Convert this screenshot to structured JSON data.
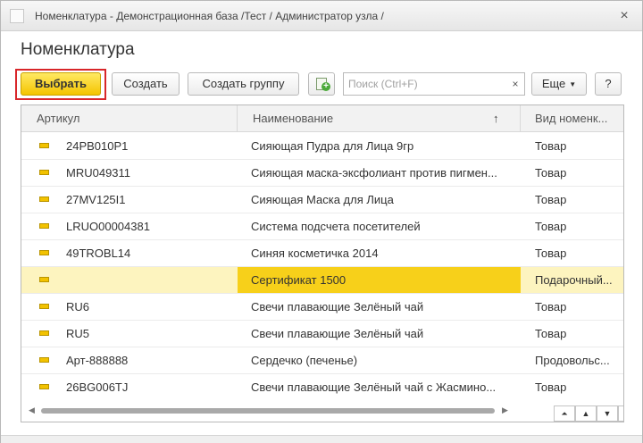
{
  "window": {
    "title": "Номенклатура - Демонстрационная база /Тест / Администратор узла /",
    "close_icon": "×"
  },
  "form": {
    "title": "Номенклатура"
  },
  "toolbar": {
    "select_label": "Выбрать",
    "create_label": "Создать",
    "create_group_label": "Создать группу",
    "search_placeholder": "Поиск (Ctrl+F)",
    "search_value": "",
    "clear_icon": "×",
    "more_label": "Еще",
    "more_caret": "▼",
    "help_label": "?"
  },
  "table": {
    "columns": {
      "article": "Артикул",
      "name": "Наименование",
      "sort_indicator": "↑",
      "kind": "Вид номенк..."
    },
    "rows": [
      {
        "article": "24PB010P1",
        "name": "Сияющая Пудра для Лица 9гр",
        "kind": "Товар"
      },
      {
        "article": "MRU049311",
        "name": "Сияющая маска-эксфолиант против пигмен...",
        "kind": "Товар"
      },
      {
        "article": "27MV125I1",
        "name": "Сияющая Маска для Лица",
        "kind": "Товар"
      },
      {
        "article": "LRUO00004381",
        "name": "Система подсчета посетителей",
        "kind": "Товар"
      },
      {
        "article": "49TROBL14",
        "name": "Синяя косметичка 2014",
        "kind": "Товар"
      },
      {
        "article": "",
        "name": "Сертификат 1500",
        "kind": "Подарочный...",
        "selected": true
      },
      {
        "article": "RU6",
        "name": "Свечи плавающие Зелёный чай",
        "kind": "Товар"
      },
      {
        "article": "RU5",
        "name": "Свечи плавающие Зелёный чай",
        "kind": "Товар"
      },
      {
        "article": "Арт-888888",
        "name": "Сердечко (печенье)",
        "kind": "Продовольс..."
      },
      {
        "article": "26BG006TJ",
        "name": "Свечи плавающие Зелёный чай с Жасмино...",
        "kind": "Товар"
      }
    ],
    "nav": {
      "first": "⏶",
      "prev": "▲",
      "next": "▼",
      "last": "⏷"
    },
    "scroll": {
      "left": "◀",
      "right": "▶"
    }
  },
  "colors": {
    "primary_button": "#f4c400",
    "selected_row": "#fdf4bf",
    "selected_cell": "#f7d01a",
    "highlight_frame": "#d8262a"
  }
}
